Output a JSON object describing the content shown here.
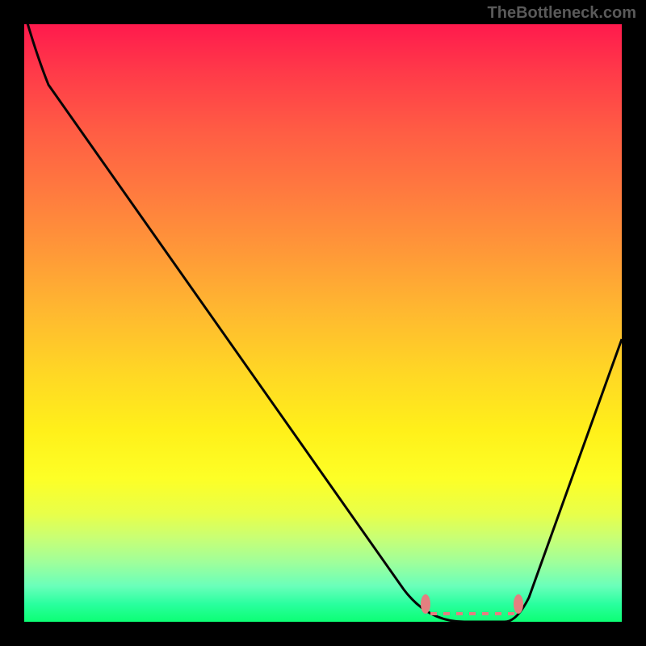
{
  "watermark": "TheBottleneck.com",
  "chart_data": {
    "type": "line",
    "title": "",
    "xlabel": "",
    "ylabel": "",
    "xlim": [
      0,
      100
    ],
    "ylim": [
      0,
      100
    ],
    "x": [
      0,
      3,
      10,
      20,
      30,
      40,
      50,
      55,
      60,
      65,
      70,
      75,
      80,
      85,
      90,
      95,
      100
    ],
    "values": [
      102,
      98,
      88,
      74,
      60,
      46,
      32,
      24,
      16,
      8,
      2,
      0,
      0,
      6,
      18,
      32,
      48
    ],
    "markers": {
      "left": {
        "x": 70,
        "y": 3
      },
      "right": {
        "x": 83,
        "y": 3
      }
    },
    "annotations": []
  },
  "colors": {
    "background": "#000000",
    "gradient_top": "#ff1a4d",
    "gradient_bottom": "#0cff74",
    "curve": "#050505",
    "marker": "#e38080"
  }
}
